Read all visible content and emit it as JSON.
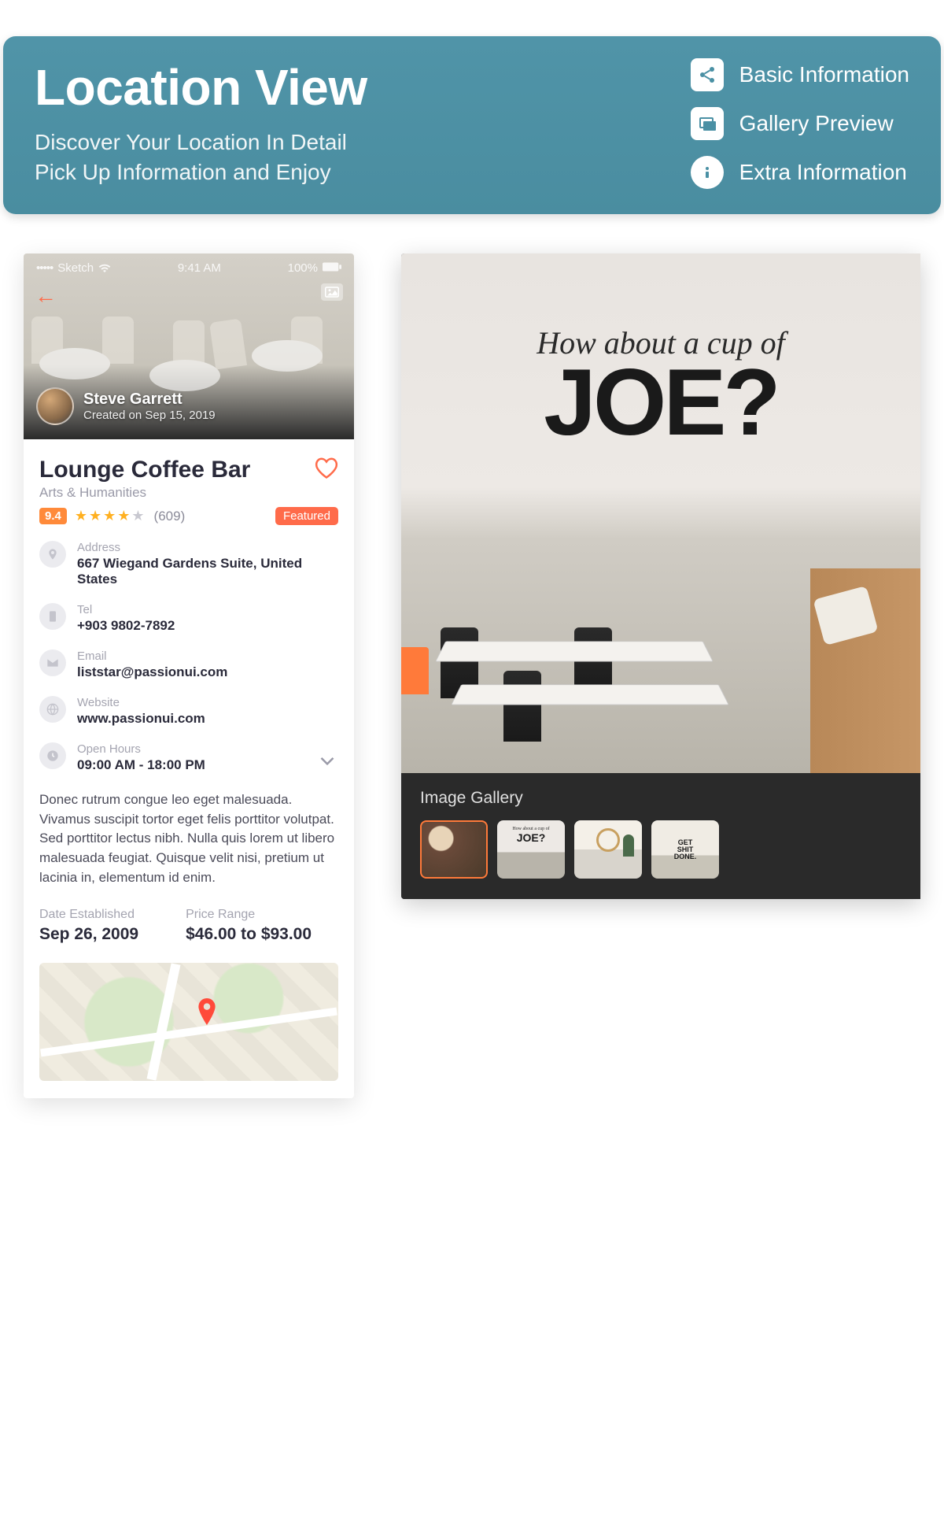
{
  "banner": {
    "title": "Location View",
    "sub_line1": "Discover Your Location In Detail",
    "sub_line2": "Pick Up Information and Enjoy",
    "items": [
      {
        "label": "Basic Information"
      },
      {
        "label": "Gallery Preview"
      },
      {
        "label": "Extra Information"
      }
    ]
  },
  "phone1": {
    "status": {
      "carrier": "Sketch",
      "time": "9:41 AM",
      "battery": "100%"
    },
    "author": {
      "name": "Steve Garrett",
      "created": "Created on Sep 15, 2019"
    },
    "title": "Lounge Coffee Bar",
    "category": "Arts & Humanities",
    "rating": {
      "score": "9.4",
      "count": "(609)"
    },
    "featured": "Featured",
    "info": {
      "address": {
        "label": "Address",
        "value": "667 Wiegand Gardens Suite, United States"
      },
      "tel": {
        "label": "Tel",
        "value": "+903 9802-7892"
      },
      "email": {
        "label": "Email",
        "value": "liststar@passionui.com"
      },
      "website": {
        "label": "Website",
        "value": "www.passionui.com"
      },
      "hours": {
        "label": "Open Hours",
        "value": "09:00 AM - 18:00 PM"
      }
    },
    "description": "Donec rutrum congue leo eget malesuada. Vivamus suscipit tortor eget felis porttitor volutpat. Sed porttitor lectus nibh. Nulla quis lorem ut libero malesuada feugiat. Quisque velit nisi, pretium ut lacinia in, elementum id enim.",
    "meta": {
      "established": {
        "label": "Date Established",
        "value": "Sep 26, 2009"
      },
      "price": {
        "label": "Price Range",
        "value": "$46.00 to $93.00"
      }
    }
  },
  "phone2": {
    "hero_script": "How about a cup of",
    "hero_big": "JOE?",
    "gallery_title": "Image Gallery",
    "thumb2_script": "How about a cup of",
    "thumb2_big": "JOE?",
    "thumb4_text": "GET\nSHIT\nDONE."
  }
}
